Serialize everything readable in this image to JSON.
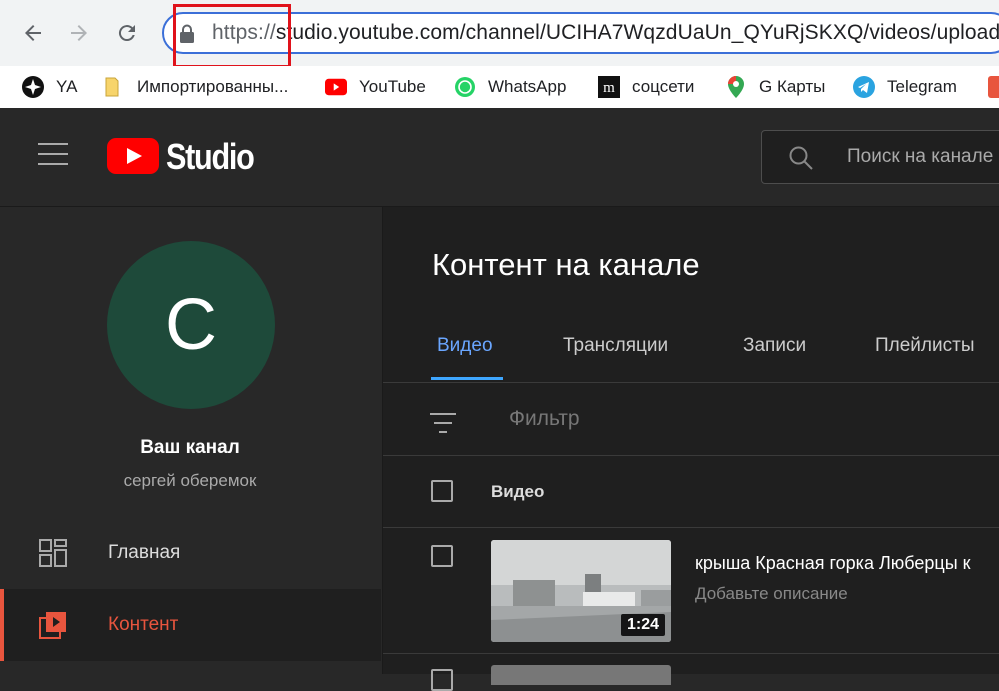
{
  "browser": {
    "url_prefix": "https://",
    "url_rest": "studio.youtube.com/channel/UCIHA7WqzdUaUn_QYuRjSKXQ/videos/upload?",
    "icons": {
      "back": "back-arrow-icon",
      "forward": "forward-arrow-icon",
      "reload": "reload-icon",
      "lock": "lock-icon"
    }
  },
  "bookmarks": [
    {
      "label": "YA",
      "icon": "sparkle-icon"
    },
    {
      "label": "Импортированны...",
      "icon": "folder-icon"
    },
    {
      "label": "YouTube",
      "icon": "youtube-icon"
    },
    {
      "label": "WhatsApp",
      "icon": "whatsapp-icon"
    },
    {
      "label": "соцсети",
      "icon": "m-icon"
    },
    {
      "label": "G Карты",
      "icon": "maps-icon"
    },
    {
      "label": "Telegram",
      "icon": "telegram-icon"
    }
  ],
  "studio": {
    "logo_text": "Studio",
    "search_placeholder": "Поиск на канале"
  },
  "sidebar": {
    "avatar_letter": "C",
    "channel_title": "Ваш канал",
    "channel_owner": "сергей оберемок",
    "items": [
      {
        "label": "Главная",
        "icon": "dashboard-icon"
      },
      {
        "label": "Контент",
        "icon": "content-icon",
        "active": true
      }
    ]
  },
  "main": {
    "title": "Контент на канале",
    "tabs": [
      "Видео",
      "Трансляции",
      "Записи",
      "Плейлисты"
    ],
    "filter_placeholder": "Фильтр",
    "column_video": "Видео",
    "videos": [
      {
        "title": "крыша Красная горка Люберцы к",
        "description": "Добавьте описание",
        "duration": "1:24"
      }
    ]
  },
  "colors": {
    "accent_active": "#e8553e",
    "tab_active": "#3ea6ff",
    "youtube_red": "#ff0000",
    "avatar_bg": "#1e4a3a",
    "highlight_box": "#e0121b"
  }
}
